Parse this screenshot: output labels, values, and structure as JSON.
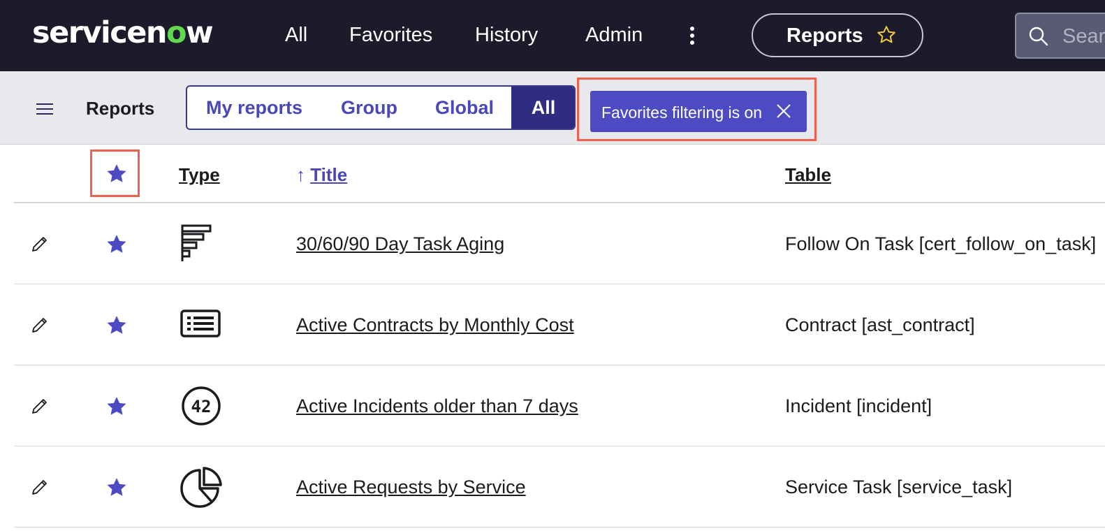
{
  "topnav": {
    "logo_prefix": "servicen",
    "logo_o": "o",
    "logo_suffix": "w",
    "items": [
      "All",
      "Favorites",
      "History",
      "Admin"
    ],
    "more_icon": "kebab-vertical-icon",
    "context_pill": "Reports",
    "context_star_icon": "star-outline-icon",
    "search_placeholder": "Search"
  },
  "subheader": {
    "title": "Reports",
    "tabs": [
      "My reports",
      "Group",
      "Global",
      "All"
    ],
    "active_tab": "All",
    "filter_chip": "Favorites filtering is on"
  },
  "colors": {
    "nav_bg": "#1c1b2b",
    "accent": "#4d4bc3",
    "active_tab_bg": "#2f2c84",
    "highlight_frame": "#f0604f",
    "logo_green": "#62d84e",
    "pill_star": "#f3c93f"
  },
  "table": {
    "columns": {
      "type": "Type",
      "title": "Title",
      "title_sort": "↑",
      "table": "Table"
    },
    "rows": [
      {
        "type_icon": "horizontal-bar-chart-icon",
        "title": "30/60/90 Day Task Aging",
        "table": "Follow On Task [cert_follow_on_task]"
      },
      {
        "type_icon": "list-report-icon",
        "title": "Active Contracts by Monthly Cost",
        "table": "Contract [ast_contract]"
      },
      {
        "type_icon": "single-score-icon",
        "score_text": "42",
        "title": "Active Incidents older than 7 days",
        "table": "Incident [incident]"
      },
      {
        "type_icon": "pie-chart-icon",
        "title": "Active Requests by Service",
        "table": "Service Task [service_task]"
      }
    ]
  }
}
